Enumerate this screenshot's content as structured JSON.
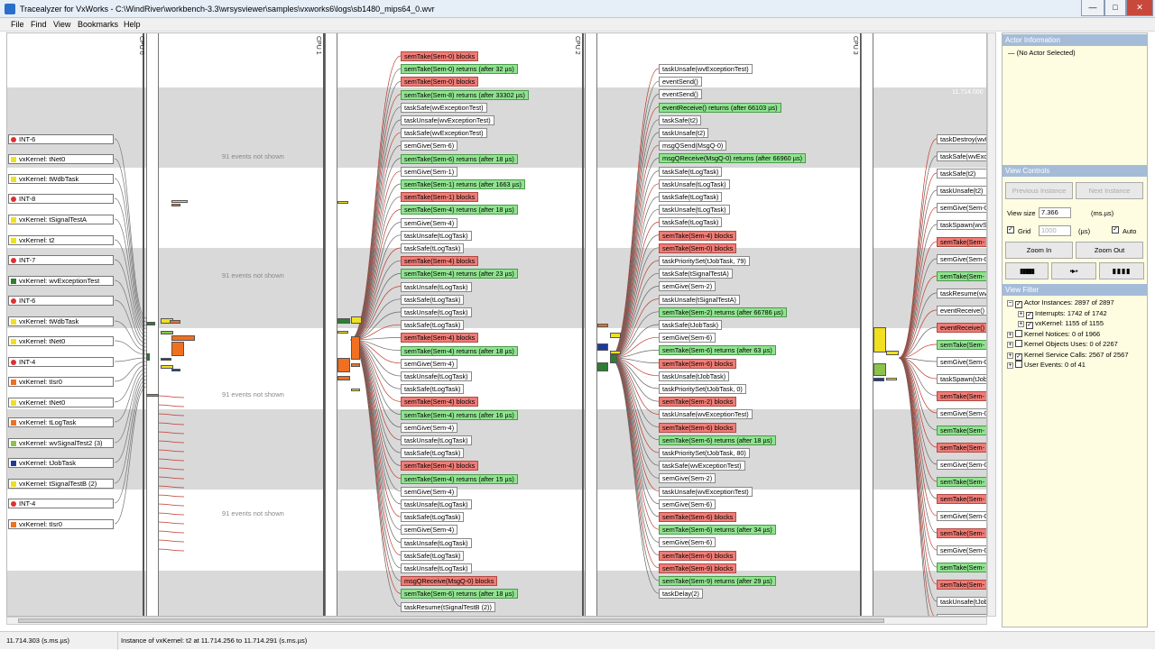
{
  "window": {
    "title": "Tracealyzer for VxWorks - C:\\WindRiver\\workbench-3.3\\wrsysviewer\\samples\\vxworks6\\logs\\sb1480_mips64_0.wvr",
    "minimize": "—",
    "maximize": "□",
    "close": "✕"
  },
  "menu": [
    "File",
    "Find",
    "View",
    "Bookmarks",
    "Help"
  ],
  "cpus": [
    "CPU 0",
    "CPU 1",
    "CPU 2",
    "CPU 3"
  ],
  "timestamp_label": "11.714.000",
  "hidden_events": [
    "91 events not shown",
    "91 events not shown",
    "91 events not shown",
    "91 events not shown"
  ],
  "actors": [
    {
      "label": "INT-6",
      "color": "#e03030",
      "icon": "circle"
    },
    {
      "label": "vxKernel: tNet0",
      "color": "#f0e020",
      "icon": "square"
    },
    {
      "label": "vxKernel: tWdbTask",
      "color": "#f0e020",
      "icon": "square"
    },
    {
      "label": "INT-8",
      "color": "#e03030",
      "icon": "circle"
    },
    {
      "label": "vxKernel: tSignalTestA",
      "color": "#f0e020",
      "icon": "square"
    },
    {
      "label": "vxKernel: t2",
      "color": "#f0e020",
      "icon": "square"
    },
    {
      "label": "INT-7",
      "color": "#e03030",
      "icon": "circle"
    },
    {
      "label": "vxKernel: wvExceptionTest",
      "color": "#2e7d32",
      "icon": "square"
    },
    {
      "label": "INT-6",
      "color": "#e03030",
      "icon": "circle"
    },
    {
      "label": "vxKernel: tWdbTask",
      "color": "#f0e020",
      "icon": "square"
    },
    {
      "label": "vxKernel: tNet0",
      "color": "#f0e020",
      "icon": "square"
    },
    {
      "label": "INT-4",
      "color": "#e03030",
      "icon": "circle"
    },
    {
      "label": "vxKernel: tIsr0",
      "color": "#f07020",
      "icon": "square"
    },
    {
      "label": "vxKernel: tNet0",
      "color": "#f0e020",
      "icon": "square"
    },
    {
      "label": "vxKernel: tLogTask",
      "color": "#f07020",
      "icon": "square"
    },
    {
      "label": "vxKernel: wvSignalTest2 (3)",
      "color": "#8bc34a",
      "icon": "square"
    },
    {
      "label": "vxKernel: tJobTask",
      "color": "#1a3aa0",
      "icon": "square"
    },
    {
      "label": "vxKernel: tSignalTestB (2)",
      "color": "#f0e020",
      "icon": "square"
    },
    {
      "label": "INT-4",
      "color": "#e03030",
      "icon": "circle"
    },
    {
      "label": "vxKernel: tIsr0",
      "color": "#f07020",
      "icon": "square"
    }
  ],
  "cpu1_events": [
    {
      "t": "semTake(Sem-0) blocks",
      "s": "r"
    },
    {
      "t": "semTake(Sem-0) returns (after 32 µs)",
      "s": "g"
    },
    {
      "t": "semTake(Sem-0) blocks",
      "s": "r"
    },
    {
      "t": "semTake(Sem-8) returns (after 33302 µs)",
      "s": "g"
    },
    {
      "t": "taskSafe(wvExceptionTest)",
      "s": "w"
    },
    {
      "t": "taskUnsafe(wvExceptionTest)",
      "s": "w"
    },
    {
      "t": "taskSafe(wvExceptionTest)",
      "s": "w"
    },
    {
      "t": "semGive(Sem-6)",
      "s": "w"
    },
    {
      "t": "semTake(Sem-6) returns (after 18 µs)",
      "s": "g"
    },
    {
      "t": "semGive(Sem-1)",
      "s": "w"
    },
    {
      "t": "semTake(Sem-1) returns (after 1663 µs)",
      "s": "g"
    },
    {
      "t": "semTake(Sem-1) blocks",
      "s": "r"
    },
    {
      "t": "semTake(Sem-4) returns (after 18 µs)",
      "s": "g"
    },
    {
      "t": "semGive(Sem-4)",
      "s": "w"
    },
    {
      "t": "taskUnsafe(tLogTask)",
      "s": "w"
    },
    {
      "t": "taskSafe(tLogTask)",
      "s": "w"
    },
    {
      "t": "semTake(Sem-4) blocks",
      "s": "r"
    },
    {
      "t": "semTake(Sem-4) returns (after 23 µs)",
      "s": "g"
    },
    {
      "t": "taskUnsafe(tLogTask)",
      "s": "w"
    },
    {
      "t": "taskSafe(tLogTask)",
      "s": "w"
    },
    {
      "t": "taskUnsafe(tLogTask)",
      "s": "w"
    },
    {
      "t": "taskSafe(tLogTask)",
      "s": "w"
    },
    {
      "t": "semTake(Sem-4) blocks",
      "s": "r"
    },
    {
      "t": "semTake(Sem-4) returns (after 18 µs)",
      "s": "g"
    },
    {
      "t": "semGive(Sem-4)",
      "s": "w"
    },
    {
      "t": "taskUnsafe(tLogTask)",
      "s": "w"
    },
    {
      "t": "taskSafe(tLogTask)",
      "s": "w"
    },
    {
      "t": "semTake(Sem-4) blocks",
      "s": "r"
    },
    {
      "t": "semTake(Sem-4) returns (after 16 µs)",
      "s": "g"
    },
    {
      "t": "semGive(Sem-4)",
      "s": "w"
    },
    {
      "t": "taskUnsafe(tLogTask)",
      "s": "w"
    },
    {
      "t": "taskSafe(tLogTask)",
      "s": "w"
    },
    {
      "t": "semTake(Sem-4) blocks",
      "s": "r"
    },
    {
      "t": "semTake(Sem-4) returns (after 15 µs)",
      "s": "g"
    },
    {
      "t": "semGive(Sem-4)",
      "s": "w"
    },
    {
      "t": "taskUnsafe(tLogTask)",
      "s": "w"
    },
    {
      "t": "taskSafe(tLogTask)",
      "s": "w"
    },
    {
      "t": "semGive(Sem-4)",
      "s": "w"
    },
    {
      "t": "taskUnsafe(tLogTask)",
      "s": "w"
    },
    {
      "t": "taskSafe(tLogTask)",
      "s": "w"
    },
    {
      "t": "taskUnsafe(tLogTask)",
      "s": "w"
    },
    {
      "t": "msgQReceive(MsgQ-0) blocks",
      "s": "r"
    },
    {
      "t": "semTake(Sem-6) returns (after 18 µs)",
      "s": "g"
    },
    {
      "t": "taskResume(tSignalTestB (2))",
      "s": "w"
    }
  ],
  "cpu2_events": [
    {
      "t": "taskUnsafe(wvExceptionTest)",
      "s": "w"
    },
    {
      "t": "eventSend()",
      "s": "w"
    },
    {
      "t": "eventSend()",
      "s": "w"
    },
    {
      "t": "eventReceive() returns (after 66103 µs)",
      "s": "g"
    },
    {
      "t": "taskSafe(t2)",
      "s": "w"
    },
    {
      "t": "taskUnsafe(t2)",
      "s": "w"
    },
    {
      "t": "msgQSend(MsgQ-0)",
      "s": "w"
    },
    {
      "t": "msgQReceive(MsgQ-0) returns (after 66960 µs)",
      "s": "g"
    },
    {
      "t": "taskSafe(tLogTask)",
      "s": "w"
    },
    {
      "t": "taskUnsafe(tLogTask)",
      "s": "w"
    },
    {
      "t": "taskSafe(tLogTask)",
      "s": "w"
    },
    {
      "t": "taskUnsafe(tLogTask)",
      "s": "w"
    },
    {
      "t": "taskSafe(tLogTask)",
      "s": "w"
    },
    {
      "t": "semTake(Sem-4) blocks",
      "s": "r"
    },
    {
      "t": "semTake(Sem-0) blocks",
      "s": "r"
    },
    {
      "t": "taskPrioritySet(tJobTask, 79)",
      "s": "w"
    },
    {
      "t": "taskSafe(tSignalTestA)",
      "s": "w"
    },
    {
      "t": "semGive(Sem-2)",
      "s": "w"
    },
    {
      "t": "taskUnsafe(tSignalTestA)",
      "s": "w"
    },
    {
      "t": "semTake(Sem-2) returns (after 66786 µs)",
      "s": "g"
    },
    {
      "t": "taskSafe(tJobTask)",
      "s": "w"
    },
    {
      "t": "semGive(Sem-6)",
      "s": "w"
    },
    {
      "t": "semTake(Sem-6) returns (after 63 µs)",
      "s": "g"
    },
    {
      "t": "semTake(Sem-6) blocks",
      "s": "r"
    },
    {
      "t": "taskUnsafe(tJobTask)",
      "s": "w"
    },
    {
      "t": "taskPrioritySet(tJobTask, 0)",
      "s": "w"
    },
    {
      "t": "semTake(Sem-2) blocks",
      "s": "r"
    },
    {
      "t": "taskUnsafe(wvExceptionTest)",
      "s": "w"
    },
    {
      "t": "semTake(Sem-6) blocks",
      "s": "r"
    },
    {
      "t": "semTake(Sem-6) returns (after 18 µs)",
      "s": "g"
    },
    {
      "t": "taskPrioritySet(tJobTask, 80)",
      "s": "w"
    },
    {
      "t": "taskSafe(wvExceptionTest)",
      "s": "w"
    },
    {
      "t": "semGive(Sem-2)",
      "s": "w"
    },
    {
      "t": "taskUnsafe(wvExceptionTest)",
      "s": "w"
    },
    {
      "t": "semGive(Sem-6)",
      "s": "w"
    },
    {
      "t": "semTake(Sem-6) blocks",
      "s": "r"
    },
    {
      "t": "semTake(Sem-6) returns (after 34 µs)",
      "s": "g"
    },
    {
      "t": "semGive(Sem-6)",
      "s": "w"
    },
    {
      "t": "semTake(Sem-6) blocks",
      "s": "r"
    },
    {
      "t": "semTake(Sem-9) blocks",
      "s": "r"
    },
    {
      "t": "semTake(Sem-9) returns (after 29 µs)",
      "s": "g"
    },
    {
      "t": "taskDelay(2)",
      "s": "w"
    }
  ],
  "cpu3_events": [
    {
      "t": "taskDestroy(wvEx",
      "s": "w"
    },
    {
      "t": "taskSafe(wvExce",
      "s": "w"
    },
    {
      "t": "taskSafe(t2)",
      "s": "w"
    },
    {
      "t": "taskUnsafe(t2)",
      "s": "w"
    },
    {
      "t": "semGive(Sem-0",
      "s": "w"
    },
    {
      "t": "taskSpawn(wvSi",
      "s": "w"
    },
    {
      "t": "semTake(Sem-",
      "s": "r"
    },
    {
      "t": "semGive(Sem-0",
      "s": "w"
    },
    {
      "t": "semTake(Sem-",
      "s": "g"
    },
    {
      "t": "taskResume(wvS",
      "s": "w"
    },
    {
      "t": "eventReceive() r",
      "s": "w"
    },
    {
      "t": "eventReceive() b",
      "s": "r"
    },
    {
      "t": "semTake(Sem-",
      "s": "g"
    },
    {
      "t": "semGive(Sem-0",
      "s": "w"
    },
    {
      "t": "taskSpawn(tJob",
      "s": "w"
    },
    {
      "t": "semTake(Sem-",
      "s": "r"
    },
    {
      "t": "semGive(Sem-0",
      "s": "w"
    },
    {
      "t": "semTake(Sem-",
      "s": "g"
    },
    {
      "t": "semTake(Sem-",
      "s": "r"
    },
    {
      "t": "semGive(Sem-0",
      "s": "w"
    },
    {
      "t": "semTake(Sem-",
      "s": "g"
    },
    {
      "t": "semTake(Sem-",
      "s": "r"
    },
    {
      "t": "semGive(Sem-0",
      "s": "w"
    },
    {
      "t": "semTake(Sem-",
      "s": "r"
    },
    {
      "t": "semGive(Sem-0",
      "s": "w"
    },
    {
      "t": "semTake(Sem-",
      "s": "g"
    },
    {
      "t": "semTake(Sem-",
      "s": "r"
    },
    {
      "t": "taskUnsafe(tJob",
      "s": "w"
    },
    {
      "t": "taskPrioritySet(",
      "s": "w"
    },
    {
      "t": "semTake(Sem-",
      "s": "r"
    }
  ],
  "panel": {
    "actor_info": {
      "title": "Actor Information",
      "value": "— (No Actor Selected)"
    },
    "view_controls": {
      "title": "View Controls",
      "prev": "Previous Instance",
      "next": "Next Instance",
      "view_size_label": "View size",
      "view_size_value": "7.366",
      "view_size_unit": "(ms.µs)",
      "grid_label": "Grid",
      "grid_value": "1000",
      "grid_unit": "(µs)",
      "auto_label": "Auto",
      "zoom_in": "Zoom In",
      "zoom_out": "Zoom Out"
    },
    "view_filter": {
      "title": "View Filter",
      "items": [
        {
          "label": "Actor Instances: 2897 of 2897",
          "level": 0,
          "checked": true,
          "exp": "−"
        },
        {
          "label": "Interrupts: 1742 of 1742",
          "level": 1,
          "checked": true,
          "exp": "+"
        },
        {
          "label": "vxKernel: 1155 of 1155",
          "level": 1,
          "checked": true,
          "exp": "+"
        },
        {
          "label": "Kernel Notices: 0 of 1966",
          "level": 0,
          "checked": false,
          "exp": "+"
        },
        {
          "label": "Kernel Objects Uses: 0 of 2267",
          "level": 0,
          "checked": false,
          "exp": "+"
        },
        {
          "label": "Kernel Service Calls: 2567 of 2567",
          "level": 0,
          "checked": true,
          "exp": "+"
        },
        {
          "label": "User Events: 0 of 41",
          "level": 0,
          "checked": false,
          "exp": "+"
        }
      ]
    }
  },
  "status": {
    "time": "11.714.303 (s.ms.µs)",
    "instance": "Instance of vxKernel: t2 at 11.714.256 to 11.714.291 (s.ms.µs)"
  }
}
